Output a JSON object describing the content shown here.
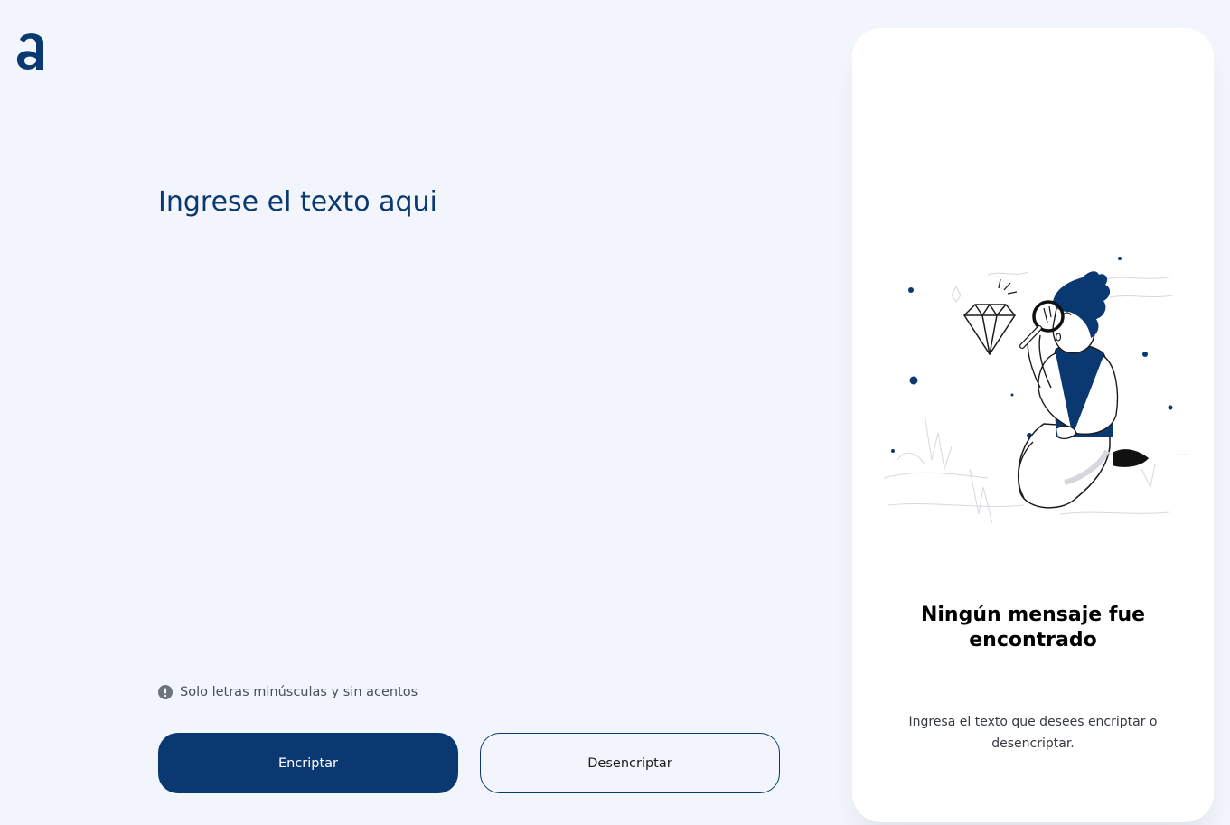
{
  "logo": {
    "icon": "alura-logo-icon",
    "color": "#0a3871"
  },
  "input": {
    "placeholder": "Ingrese el texto aqui",
    "value": ""
  },
  "hint": {
    "icon": "exclamation-circle-icon",
    "text": "Solo letras minúsculas y sin acentos"
  },
  "buttons": {
    "encrypt_label": "Encriptar",
    "decrypt_label": "Desencriptar"
  },
  "output": {
    "illustration": "person-with-magnifying-glass-illustration",
    "title": "Ningún mensaje fue encontrado",
    "description": "Ingresa el texto que desees encriptar o desencriptar."
  },
  "colors": {
    "primary": "#0a3871",
    "background": "#f3f5fc",
    "panel": "#ffffff"
  }
}
